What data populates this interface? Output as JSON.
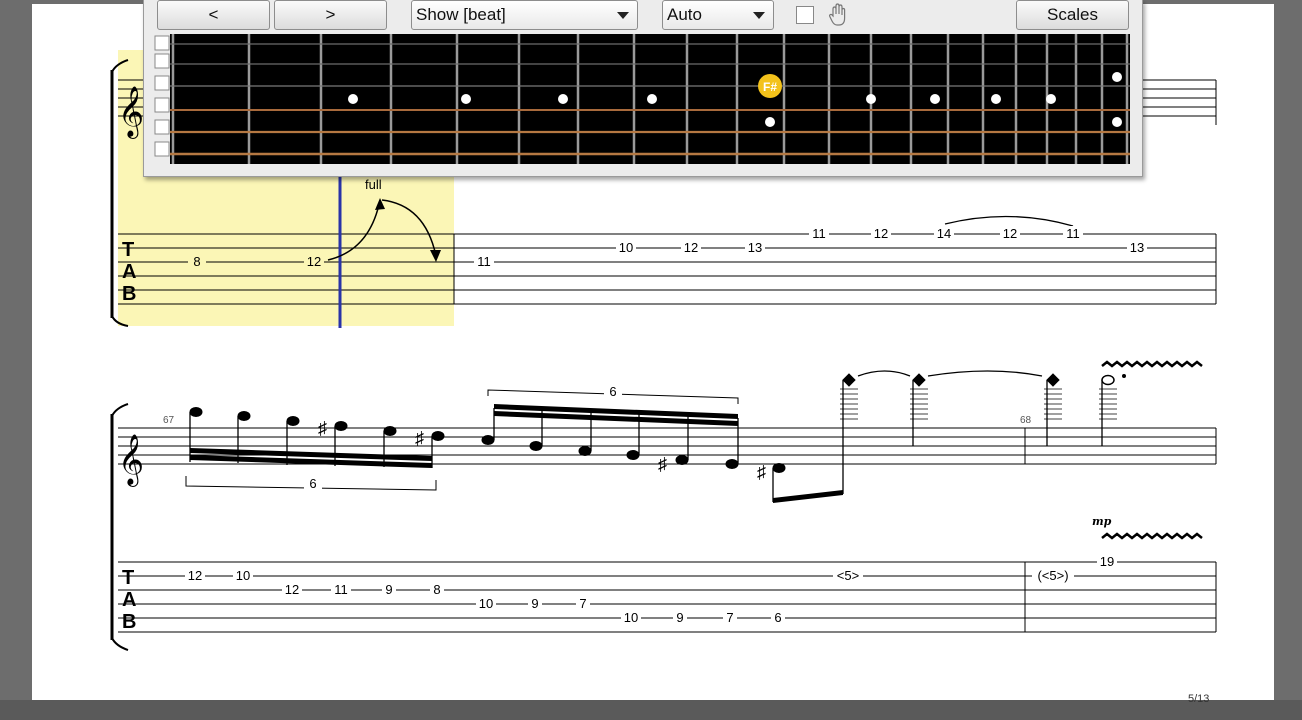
{
  "toolbar": {
    "prev_label": "<",
    "next_label": ">",
    "show_select": "Show [beat]",
    "auto_select": "Auto",
    "scales_label": "Scales"
  },
  "fretboard": {
    "highlight_note": "F#",
    "highlight_color": "#f3c21b",
    "board_color": "#000000"
  },
  "score": {
    "bend_label": "full",
    "system1_tab": [
      "8",
      "12",
      "11",
      "10",
      "12",
      "13",
      "11",
      "12",
      "14",
      "12",
      "11",
      "13"
    ],
    "system2": {
      "measure_numbers": [
        "67",
        "68"
      ],
      "tuplets": [
        "6",
        "6"
      ],
      "dynamic": "mp",
      "tab": [
        "12",
        "10",
        "12",
        "11",
        "9",
        "8",
        "10",
        "9",
        "7",
        "10",
        "9",
        "7",
        "6",
        "<5>",
        "(<5>)",
        "19"
      ]
    },
    "page_number": "5/13",
    "tab_letters": [
      "T",
      "A",
      "B"
    ]
  }
}
